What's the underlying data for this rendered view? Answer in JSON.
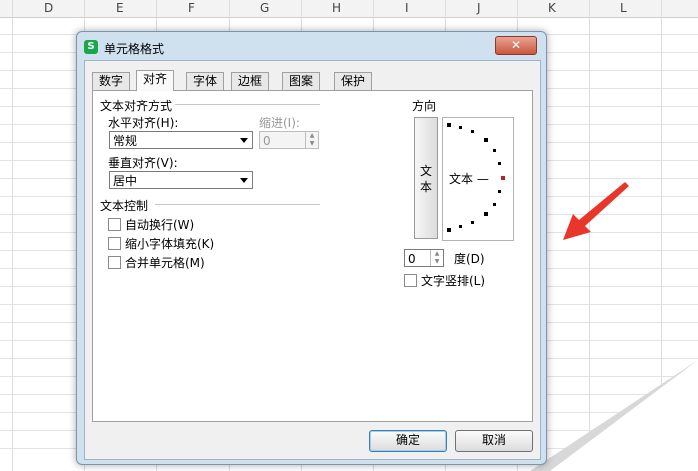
{
  "spreadsheet": {
    "columns": [
      "D",
      "E",
      "F",
      "G",
      "H",
      "I",
      "J",
      "K",
      "L"
    ]
  },
  "dialog": {
    "title": "单元格格式",
    "close_label": "✕",
    "tabs": [
      "数字",
      "对齐",
      "字体",
      "边框",
      "图案",
      "保护"
    ],
    "active_tab": "对齐",
    "alignment_group": "文本对齐方式",
    "horizontal_label": "水平对齐(H):",
    "horizontal_value": "常规",
    "indent_label": "缩进(I):",
    "indent_value": "0",
    "vertical_label": "垂直对齐(V):",
    "vertical_value": "居中",
    "control_group": "文本控制",
    "wrap_text": "自动换行(W)",
    "shrink_to_fit": "缩小字体填充(K)",
    "merge_cells": "合并单元格(M)",
    "orientation_group": "方向",
    "vertical_text_chars": [
      "文",
      "本"
    ],
    "dial_text": "文本 —",
    "degrees_value": "0",
    "degrees_label": "度(D)",
    "stacked_text": "文字竖排(L)",
    "ok_label": "确定",
    "cancel_label": "取消"
  },
  "colors": {
    "arrow": "#e8362a",
    "title_bar": "#cfe0ef",
    "app_icon": "#1aa64b"
  },
  "icons": [
    "app-icon",
    "close-icon",
    "dropdown-arrow-icon",
    "spin-arrow-icon",
    "red-arrow-annotation"
  ]
}
